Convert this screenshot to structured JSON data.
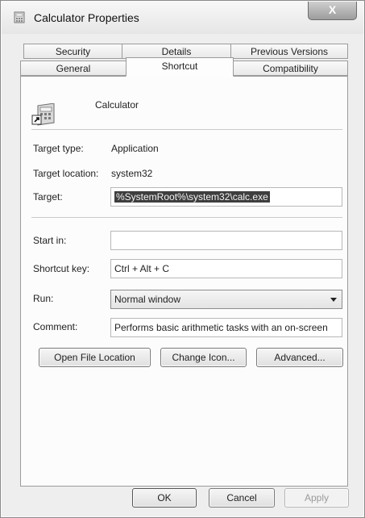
{
  "window": {
    "title": "Calculator Properties",
    "close_glyph": "X"
  },
  "tabs": {
    "row_back": [
      {
        "label": "Security"
      },
      {
        "label": "Details"
      },
      {
        "label": "Previous Versions"
      }
    ],
    "row_front": [
      {
        "label": "General"
      },
      {
        "label": "Shortcut",
        "active": true
      },
      {
        "label": "Compatibility"
      }
    ]
  },
  "shortcut": {
    "app_name": "Calculator",
    "target_type_label": "Target type:",
    "target_type_value": "Application",
    "target_location_label": "Target location:",
    "target_location_value": "system32",
    "target_label": "Target:",
    "target_value": "%SystemRoot%\\system32\\calc.exe",
    "start_in_label": "Start in:",
    "start_in_value": "",
    "shortcut_key_label": "Shortcut key:",
    "shortcut_key_value": "Ctrl + Alt + C",
    "run_label": "Run:",
    "run_value": "Normal window",
    "comment_label": "Comment:",
    "comment_value": "Performs basic arithmetic tasks with an on-screen",
    "open_file_location": "Open File Location",
    "change_icon": "Change Icon...",
    "advanced": "Advanced..."
  },
  "footer": {
    "ok": "OK",
    "cancel": "Cancel",
    "apply": "Apply"
  }
}
